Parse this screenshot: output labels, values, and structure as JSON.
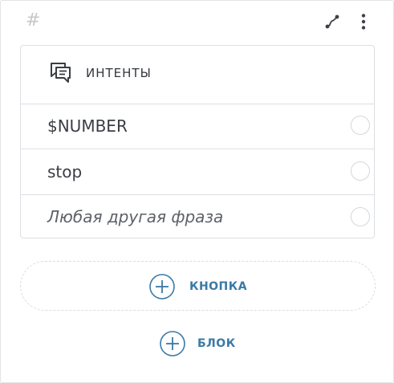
{
  "card": {
    "hash_symbol": "#"
  },
  "icons": {
    "connect": "connect-path-icon",
    "more": "more-vertical-icon",
    "chat": "chat-bubbles-icon",
    "plus": "plus-circle-icon"
  },
  "intents": {
    "title": "ИНТЕНТЫ",
    "items": [
      {
        "label": "$NUMBER"
      },
      {
        "label": "stop"
      },
      {
        "label": "Любая другая фраза"
      }
    ]
  },
  "actions": {
    "add_button_label": "КНОПКА",
    "add_block_label": "БЛОК"
  },
  "colors": {
    "accent": "#3a7aa6",
    "border": "#dcdfe3",
    "text": "#3a3d42"
  }
}
